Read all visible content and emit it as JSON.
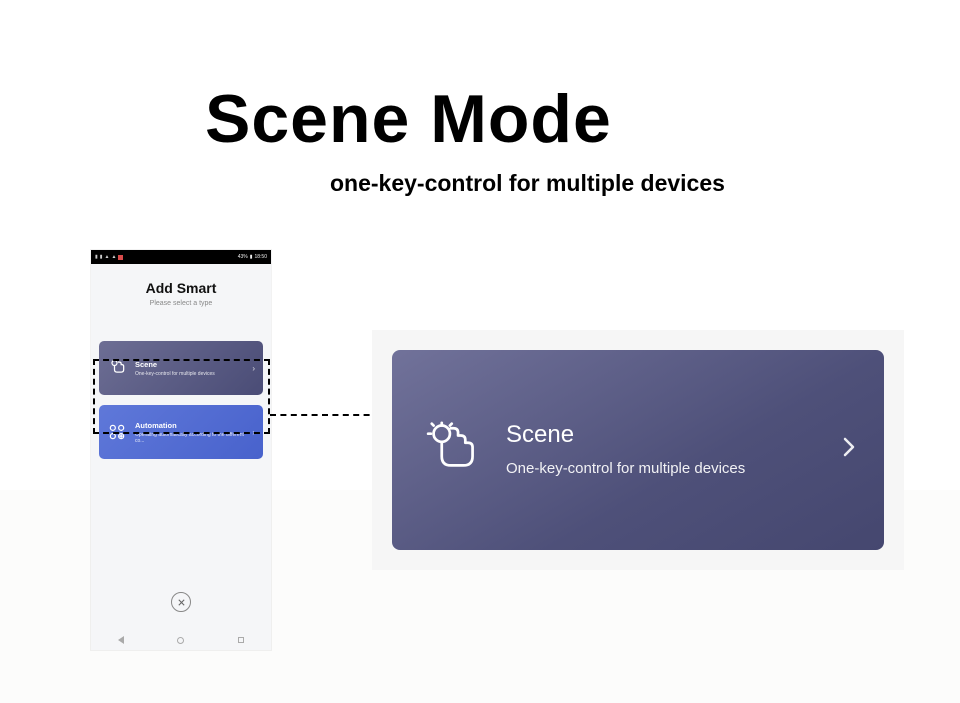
{
  "header": {
    "title": "Scene Mode",
    "subtitle": "one-key-control for multiple devices"
  },
  "phone": {
    "status": {
      "battery_text": "43%",
      "time": "18:50"
    },
    "heading": "Add Smart",
    "subheading": "Please select a type",
    "cards": {
      "scene": {
        "title": "Scene",
        "desc": "One-key-control for multiple devices"
      },
      "automation": {
        "title": "Automation",
        "desc": "Operating automatically according to the different co..."
      }
    }
  },
  "detail": {
    "title": "Scene",
    "desc": "One-key-control for multiple devices"
  }
}
